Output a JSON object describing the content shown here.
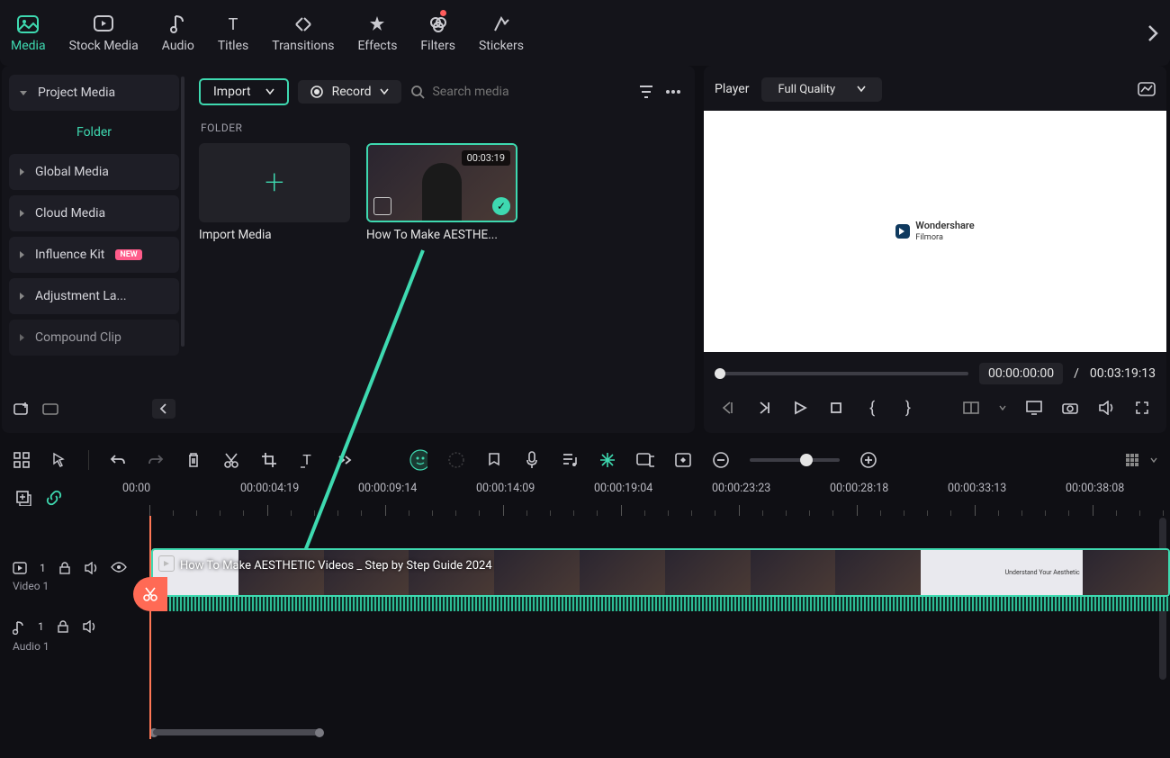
{
  "tabs": [
    {
      "label": "Media",
      "active": true,
      "name": "media"
    },
    {
      "label": "Stock Media",
      "name": "stock-media"
    },
    {
      "label": "Audio",
      "name": "audio"
    },
    {
      "label": "Titles",
      "name": "titles"
    },
    {
      "label": "Transitions",
      "name": "transitions"
    },
    {
      "label": "Effects",
      "name": "effects"
    },
    {
      "label": "Filters",
      "name": "filters",
      "dot": true
    },
    {
      "label": "Stickers",
      "name": "stickers"
    }
  ],
  "sidebar": {
    "project": "Project Media",
    "folder": "Folder",
    "items": [
      {
        "label": "Global Media"
      },
      {
        "label": "Cloud Media"
      },
      {
        "label": "Influence Kit",
        "new": true
      },
      {
        "label": "Adjustment La..."
      },
      {
        "label": "Compound Clip"
      }
    ]
  },
  "toolbar": {
    "import": "Import",
    "record": "Record",
    "search_ph": "Search media",
    "folder_label": "FOLDER"
  },
  "thumbs": {
    "import": "Import Media",
    "clip": {
      "title": "How To Make AESTHE...",
      "duration": "00:03:19"
    }
  },
  "player": {
    "label": "Player",
    "quality": "Full Quality",
    "cur_time": "00:00:00:00",
    "sep": "/",
    "dur": "00:03:19:13",
    "logo1": "Wondershare",
    "logo2": "Filmora"
  },
  "ruler": {
    "start": "00:00",
    "marks": [
      "00:00:04:19",
      "00:00:09:14",
      "00:00:14:09",
      "00:00:19:04",
      "00:00:23:23",
      "00:00:28:18",
      "00:00:33:13",
      "00:00:38:08"
    ]
  },
  "tracks": {
    "video": {
      "name": "Video 1",
      "count": "1",
      "clip_title": "How To Make AESTHETIC Videos _ Step by Step Guide 2024",
      "clip_card": "Understand Your Aesthetic"
    },
    "audio": {
      "name": "Audio 1",
      "count": "1"
    }
  }
}
